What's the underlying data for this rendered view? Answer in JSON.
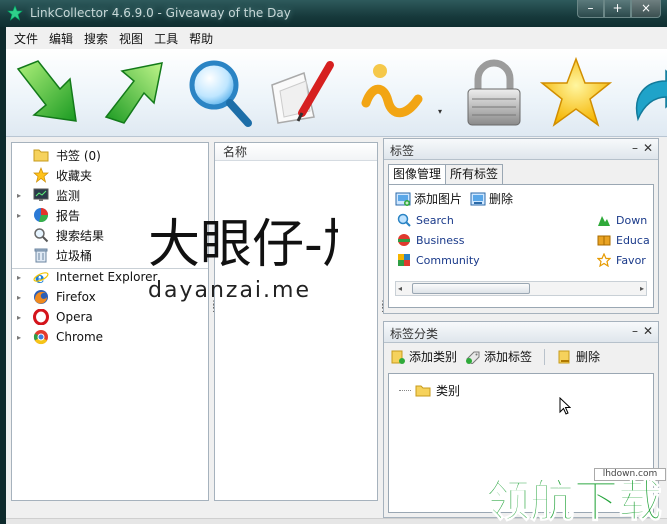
{
  "window": {
    "title": "LinkCollector 4.6.9.0 - Giveaway of the Day",
    "buttons": {
      "minimize": "–",
      "maximize": "+",
      "close": "×"
    }
  },
  "menu": [
    "文件",
    "编辑",
    "搜索",
    "视图",
    "工具",
    "帮助"
  ],
  "toolbar": {
    "buttons": [
      {
        "name": "add-link-icon"
      },
      {
        "name": "go-up-icon"
      },
      {
        "name": "search-magnifier-icon"
      },
      {
        "name": "edit-note-icon"
      },
      {
        "name": "tags-icon"
      },
      {
        "name": "lock-icon"
      },
      {
        "name": "favorite-star-icon"
      },
      {
        "name": "export-arrow-icon"
      }
    ],
    "dropdown_glyph": "▾"
  },
  "tree": {
    "items": [
      {
        "label": "书签 (0)",
        "icon": "folder-icon",
        "arrow": ""
      },
      {
        "label": "收藏夹",
        "icon": "star-icon",
        "arrow": ""
      },
      {
        "label": "监测",
        "icon": "monitor-icon",
        "arrow": "▸"
      },
      {
        "label": "报告",
        "icon": "pie-chart-icon",
        "arrow": "▸"
      },
      {
        "label": "搜索结果",
        "icon": "search-icon",
        "arrow": ""
      },
      {
        "label": "垃圾桶",
        "icon": "trash-icon",
        "arrow": ""
      },
      {
        "label": "Internet Explorer",
        "icon": "ie-icon",
        "arrow": "▸"
      },
      {
        "label": "Firefox",
        "icon": "firefox-icon",
        "arrow": "▸"
      },
      {
        "label": "Opera",
        "icon": "opera-icon",
        "arrow": "▸"
      },
      {
        "label": "Chrome",
        "icon": "chrome-icon",
        "arrow": "▸"
      }
    ]
  },
  "list": {
    "column_name": "名称"
  },
  "tags_panel": {
    "title": "标签",
    "min": "–",
    "close": "✕",
    "tabs": [
      "图像管理",
      "所有标签"
    ],
    "actions": {
      "add_image": "添加图片",
      "delete": "删除"
    },
    "items_left": [
      "Search",
      "Business",
      "Community"
    ],
    "items_right": [
      "Down",
      "Educa",
      "Favor"
    ],
    "scroll_left": "◂",
    "scroll_right": "▸"
  },
  "category_panel": {
    "title": "标签分类",
    "min": "–",
    "close": "✕",
    "actions": {
      "add_category": "添加类别",
      "add_tag": "添加标签",
      "delete": "删除"
    },
    "node": "类别"
  },
  "watermark": {
    "cn": "大眼仔-旭",
    "url": "dayanzai.me",
    "badge": "lhdown.com",
    "logo": "领航下载"
  }
}
